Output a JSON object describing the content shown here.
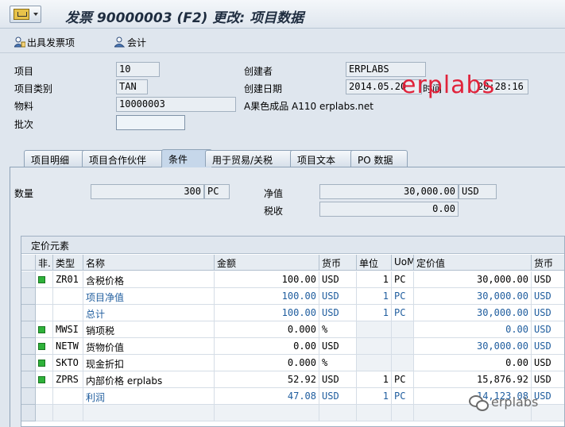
{
  "window": {
    "title": "发票 90000003 (F2) 更改: 项目数据"
  },
  "toolbar": {
    "btn1": "出具发票项",
    "btn2": "会计"
  },
  "header": {
    "item_label": "项目",
    "item_value": "10",
    "category_label": "项目类别",
    "category_value": "TAN",
    "material_label": "物料",
    "material_value": "10000003",
    "batch_label": "批次",
    "batch_value": "",
    "creator_label": "创建者",
    "creator_value": "ERPLABS",
    "date_label": "创建日期",
    "date_value": "2014.05.20",
    "time_label": "时间",
    "time_value": "20:28:16",
    "material_desc": "A果色成品 A110 erplabs.net"
  },
  "watermark": "erplabs",
  "footer_mark": "erplabs",
  "tabs": [
    "项目明细",
    "项目合作伙伴",
    "条件",
    "用于贸易/关税",
    "项目文本",
    "PO 数据"
  ],
  "conditions": {
    "qty_label": "数量",
    "qty_value": "300",
    "qty_unit": "PC",
    "net_label": "净值",
    "net_value": "30,000.00",
    "net_currency": "USD",
    "tax_label": "税收",
    "tax_value": "0.00"
  },
  "pricing": {
    "title": "定价元素",
    "columns": [
      "非.",
      "类型",
      "名称",
      "金额",
      "货币",
      "单位",
      "UoM",
      "定价值",
      "货币"
    ],
    "rows": [
      {
        "led": true,
        "type": "ZR01",
        "name": "含税价格",
        "amount": "100.00",
        "curr": "USD",
        "per": "1",
        "uom": "PC",
        "value": "30,000.00",
        "curr2": "USD",
        "blue": false
      },
      {
        "led": false,
        "type": "",
        "name": "项目净值",
        "amount": "100.00",
        "curr": "USD",
        "per": "1",
        "uom": "PC",
        "value": "30,000.00",
        "curr2": "USD",
        "blue": true
      },
      {
        "led": false,
        "type": "",
        "name": "总计",
        "amount": "100.00",
        "curr": "USD",
        "per": "1",
        "uom": "PC",
        "value": "30,000.00",
        "curr2": "USD",
        "blue": true
      },
      {
        "led": true,
        "type": "MWSI",
        "name": "销项税",
        "amount": "0.000",
        "curr": "%",
        "per": "",
        "uom": "",
        "value": "0.00",
        "curr2": "USD",
        "blue": false,
        "valueBlue": true
      },
      {
        "led": true,
        "type": "NETW",
        "name": "货物价值",
        "amount": "0.00",
        "curr": "USD",
        "per": "",
        "uom": "",
        "value": "30,000.00",
        "curr2": "USD",
        "blue": false,
        "valueBlue": true
      },
      {
        "led": true,
        "type": "SKTO",
        "name": "现金折扣",
        "amount": "0.000",
        "curr": "%",
        "per": "",
        "uom": "",
        "value": "0.00",
        "curr2": "USD",
        "blue": false
      },
      {
        "led": true,
        "type": "ZPRS",
        "name": "内部价格 erplabs",
        "amount": "52.92",
        "curr": "USD",
        "per": "1",
        "uom": "PC",
        "value": "15,876.92",
        "curr2": "USD",
        "blue": false
      },
      {
        "led": false,
        "type": "",
        "name": "利润",
        "amount": "47.08",
        "curr": "USD",
        "per": "1",
        "uom": "PC",
        "value": "14,123.08",
        "curr2": "USD",
        "blue": true
      }
    ]
  }
}
